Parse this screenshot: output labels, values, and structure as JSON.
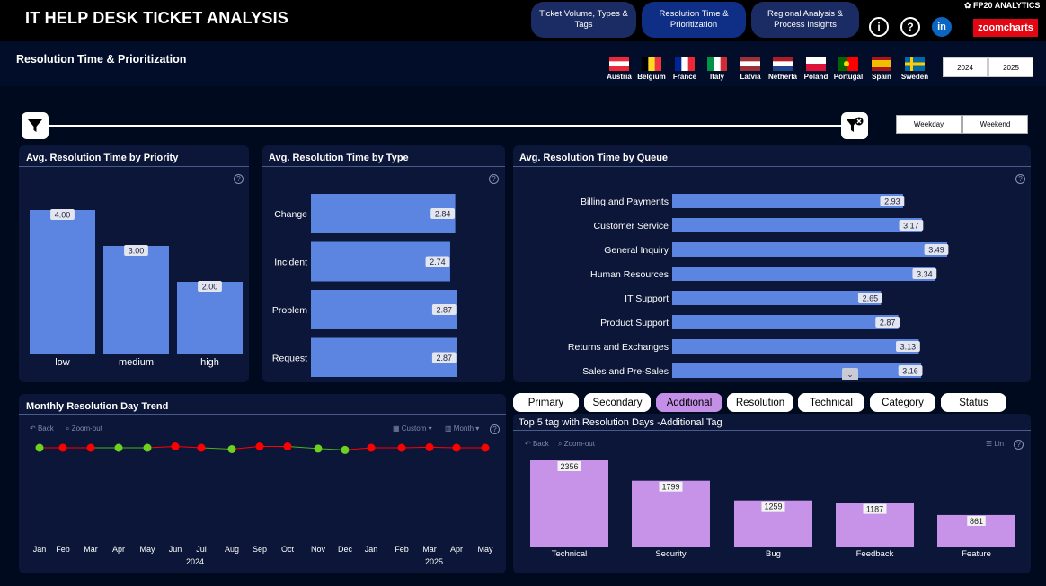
{
  "header": {
    "title": "IT HELP DESK TICKET ANALYSIS",
    "brand": "FP20 ANALYTICS",
    "nav": [
      {
        "label_line1": "Ticket Volume, Types &",
        "label_line2": "Tags"
      },
      {
        "label_line1": "Resolution Time &",
        "label_line2": "Prioritization"
      },
      {
        "label_line1": "Regional Analysis &",
        "label_line2": "Process Insights"
      }
    ],
    "info_icon": "i",
    "help_icon": "?",
    "linkedin_icon": "in",
    "zoomcharts_logo": "zoomcharts"
  },
  "section_title": "Resolution Time & Prioritization",
  "countries": [
    "Austria",
    "Belgium",
    "France",
    "Italy",
    "Latvia",
    "Netherla",
    "Poland",
    "Portugal",
    "Spain",
    "Sweden"
  ],
  "years": [
    "2024",
    "2025"
  ],
  "day_filters": [
    "Weekday",
    "Weekend"
  ],
  "priority_chart": {
    "title": "Avg. Resolution Time by Priority",
    "chart_data": {
      "type": "bar",
      "categories": [
        "low",
        "medium",
        "high"
      ],
      "values": [
        4.0,
        3.0,
        2.0
      ],
      "value_labels": [
        "4.00",
        "3.00",
        "2.00"
      ],
      "ylim": [
        0,
        4.3
      ]
    }
  },
  "type_chart": {
    "title": "Avg. Resolution Time by Type",
    "chart_data": {
      "type": "bar",
      "orientation": "horizontal",
      "categories": [
        "Change",
        "Incident",
        "Problem",
        "Request"
      ],
      "values": [
        2.84,
        2.74,
        2.87,
        2.87
      ],
      "value_labels": [
        "2.84",
        "2.74",
        "2.87",
        "2.87"
      ],
      "xlim": [
        0,
        2.9
      ]
    }
  },
  "queue_chart": {
    "title": "Avg. Resolution Time by Queue",
    "chart_data": {
      "type": "bar",
      "orientation": "horizontal",
      "categories": [
        "Billing and Payments",
        "Customer Service",
        "General Inquiry",
        "Human Resources",
        "IT Support",
        "Product Support",
        "Returns and Exchanges",
        "Sales and Pre-Sales"
      ],
      "values": [
        2.93,
        3.17,
        3.49,
        3.34,
        2.65,
        2.87,
        3.13,
        3.16
      ],
      "value_labels": [
        "2.93",
        "3.17",
        "3.49",
        "3.34",
        "2.65",
        "2.87",
        "3.13",
        "3.16"
      ],
      "xlim": [
        0,
        3.49
      ]
    }
  },
  "trend_chart": {
    "title": "Monthly Resolution Day Trend",
    "controls": {
      "back": "Back",
      "zoom_out": "Zoom-out",
      "custom": "Custom",
      "month": "Month"
    },
    "chart_data": {
      "type": "line",
      "x": [
        "Jan",
        "Feb",
        "Mar",
        "Apr",
        "May",
        "Jun",
        "Jul",
        "Aug",
        "Sep",
        "Oct",
        "Nov",
        "Dec",
        "Jan",
        "Feb",
        "Mar",
        "Apr",
        "May"
      ],
      "year_labels": [
        "2024",
        "2025"
      ],
      "values": [
        3.0,
        3.0,
        3.0,
        3.0,
        3.0,
        3.05,
        3.0,
        2.95,
        3.05,
        3.05,
        2.97,
        2.92,
        3.0,
        3.0,
        3.02,
        3.0,
        3.0
      ],
      "point_colors": [
        "#6ed11e",
        "#ff0000",
        "#ff0000",
        "#6ed11e",
        "#6ed11e",
        "#ff0000",
        "#ff0000",
        "#6ed11e",
        "#ff0000",
        "#ff0000",
        "#6ed11e",
        "#6ed11e",
        "#ff0000",
        "#ff0000",
        "#ff0000",
        "#ff0000",
        "#ff0000"
      ],
      "ylim": [
        2.0,
        4.0
      ]
    }
  },
  "tag_tabs": [
    "Primary",
    "Secondary",
    "Additional",
    "Resolution",
    "Technical",
    "Category",
    "Status"
  ],
  "active_tag_tab": "Additional",
  "tag_chart": {
    "title": "Top 5 tag with Resolution Days -Additional Tag",
    "controls": {
      "back": "Back",
      "zoom_out": "Zoom-out",
      "lin": "Lin"
    },
    "chart_data": {
      "type": "bar",
      "categories": [
        "Technical",
        "Security",
        "Bug",
        "Feedback",
        "Feature"
      ],
      "values": [
        2356,
        1799,
        1259,
        1187,
        861
      ],
      "value_labels": [
        "2356",
        "1799",
        "1259",
        "1187",
        "861"
      ],
      "ylim": [
        0,
        2356
      ]
    }
  },
  "colors": {
    "bar_blue": "#5b85e0",
    "bar_purple": "#c793e8",
    "card_bg": "#0b1638",
    "page_bg": "#000a1f",
    "accent_red": "#e30613"
  }
}
